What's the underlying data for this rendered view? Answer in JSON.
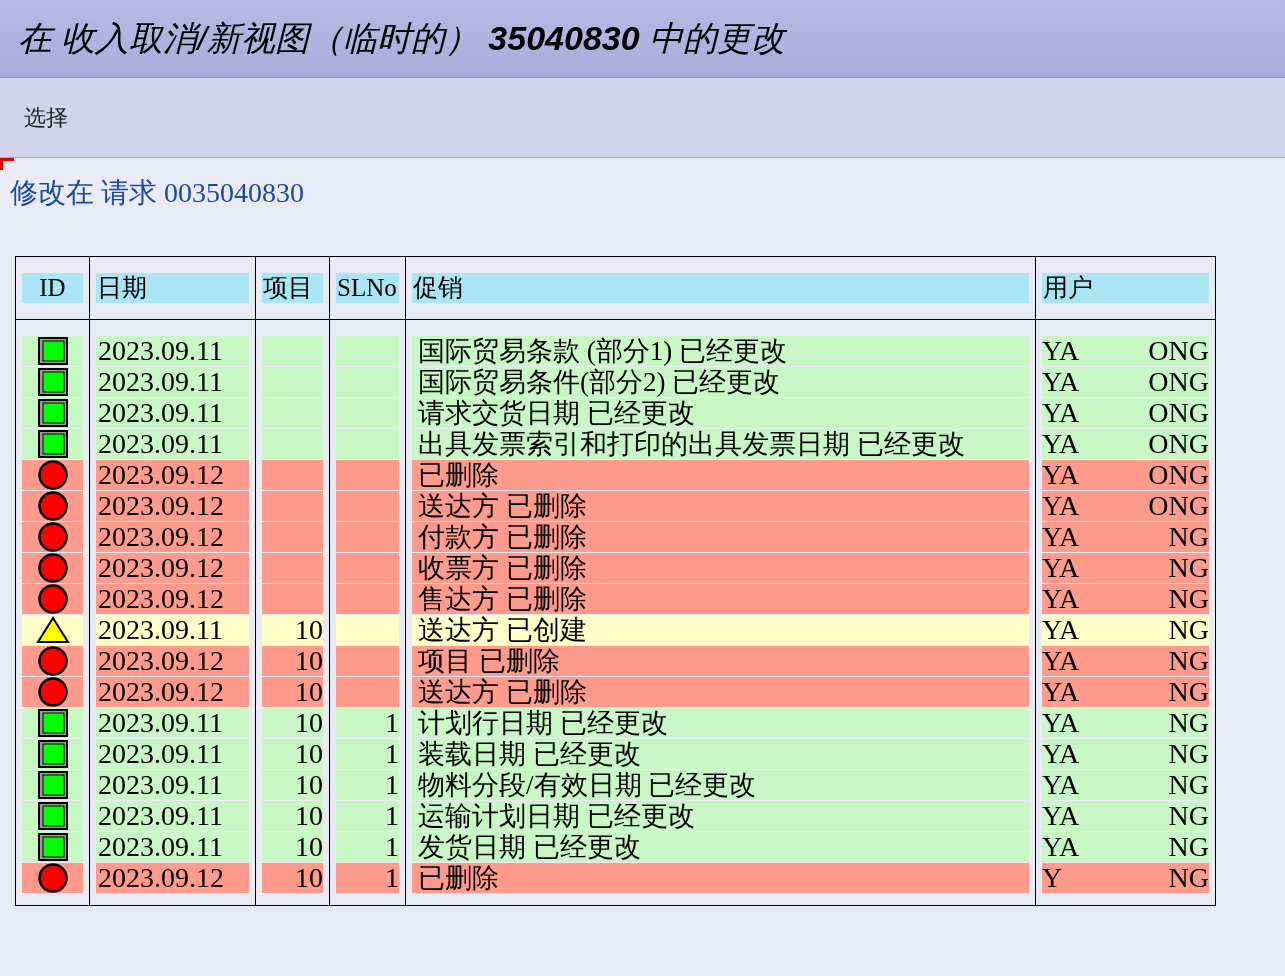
{
  "window": {
    "title_parts": [
      {
        "text": "在 收入取消/新视图（临时的） ",
        "bold": false
      },
      {
        "text": "35040830",
        "bold": true
      },
      {
        "text": " 中的更改",
        "bold": false
      }
    ]
  },
  "toolbar": {
    "items": [
      "选择"
    ]
  },
  "heading": "修改在  请求 0035040830",
  "table": {
    "columns": [
      "ID",
      "日期",
      "项目",
      "SLNo",
      "促销",
      "用户"
    ],
    "rows": [
      {
        "kind": "changed",
        "date": "2023.09.11",
        "item": "",
        "slno": "",
        "promo": "国际贸易条款 (部分1) 已经更改",
        "user_start": "YA",
        "user_end": "ONG"
      },
      {
        "kind": "changed",
        "date": "2023.09.11",
        "item": "",
        "slno": "",
        "promo": "国际贸易条件(部分2) 已经更改",
        "user_start": "YA",
        "user_end": "ONG"
      },
      {
        "kind": "changed",
        "date": "2023.09.11",
        "item": "",
        "slno": "",
        "promo": "请求交货日期 已经更改",
        "user_start": "YA",
        "user_end": "ONG"
      },
      {
        "kind": "changed",
        "date": "2023.09.11",
        "item": "",
        "slno": "",
        "promo": "出具发票索引和打印的出具发票日期 已经更改",
        "user_start": "YA",
        "user_end": "ONG"
      },
      {
        "kind": "deleted",
        "date": "2023.09.12",
        "item": "",
        "slno": "",
        "promo": "已删除",
        "user_start": "YA",
        "user_end": "ONG"
      },
      {
        "kind": "deleted",
        "date": "2023.09.12",
        "item": "",
        "slno": "",
        "promo": "送达方 已删除",
        "user_start": "YA",
        "user_end": "ONG"
      },
      {
        "kind": "deleted",
        "date": "2023.09.12",
        "item": "",
        "slno": "",
        "promo": "付款方 已删除",
        "user_start": "YA",
        "user_end": "NG"
      },
      {
        "kind": "deleted",
        "date": "2023.09.12",
        "item": "",
        "slno": "",
        "promo": "收票方 已删除",
        "user_start": "YA",
        "user_end": "NG"
      },
      {
        "kind": "deleted",
        "date": "2023.09.12",
        "item": "",
        "slno": "",
        "promo": "售达方 已删除",
        "user_start": "YA",
        "user_end": "NG"
      },
      {
        "kind": "created",
        "date": "2023.09.11",
        "item": "10",
        "slno": "",
        "promo": "送达方 已创建",
        "user_start": "YA",
        "user_end": "NG"
      },
      {
        "kind": "deleted",
        "date": "2023.09.12",
        "item": "10",
        "slno": "",
        "promo": "项目 已删除",
        "user_start": "YA",
        "user_end": "NG"
      },
      {
        "kind": "deleted",
        "date": "2023.09.12",
        "item": "10",
        "slno": "",
        "promo": "送达方 已删除",
        "user_start": "YA",
        "user_end": "NG"
      },
      {
        "kind": "changed",
        "date": "2023.09.11",
        "item": "10",
        "slno": "1",
        "promo": "计划行日期 已经更改",
        "user_start": "YA",
        "user_end": "NG"
      },
      {
        "kind": "changed",
        "date": "2023.09.11",
        "item": "10",
        "slno": "1",
        "promo": "装载日期 已经更改",
        "user_start": "YA",
        "user_end": "NG"
      },
      {
        "kind": "changed",
        "date": "2023.09.11",
        "item": "10",
        "slno": "1",
        "promo": "物料分段/有效日期 已经更改",
        "user_start": "YA",
        "user_end": "NG"
      },
      {
        "kind": "changed",
        "date": "2023.09.11",
        "item": "10",
        "slno": "1",
        "promo": "运输计划日期 已经更改",
        "user_start": "YA",
        "user_end": "NG"
      },
      {
        "kind": "changed",
        "date": "2023.09.11",
        "item": "10",
        "slno": "1",
        "promo": "发货日期 已经更改",
        "user_start": "YA",
        "user_end": "NG"
      },
      {
        "kind": "deleted",
        "date": "2023.09.12",
        "item": "10",
        "slno": "1",
        "promo": "已删除",
        "user_start": "Y",
        "user_end": "NG"
      }
    ]
  }
}
